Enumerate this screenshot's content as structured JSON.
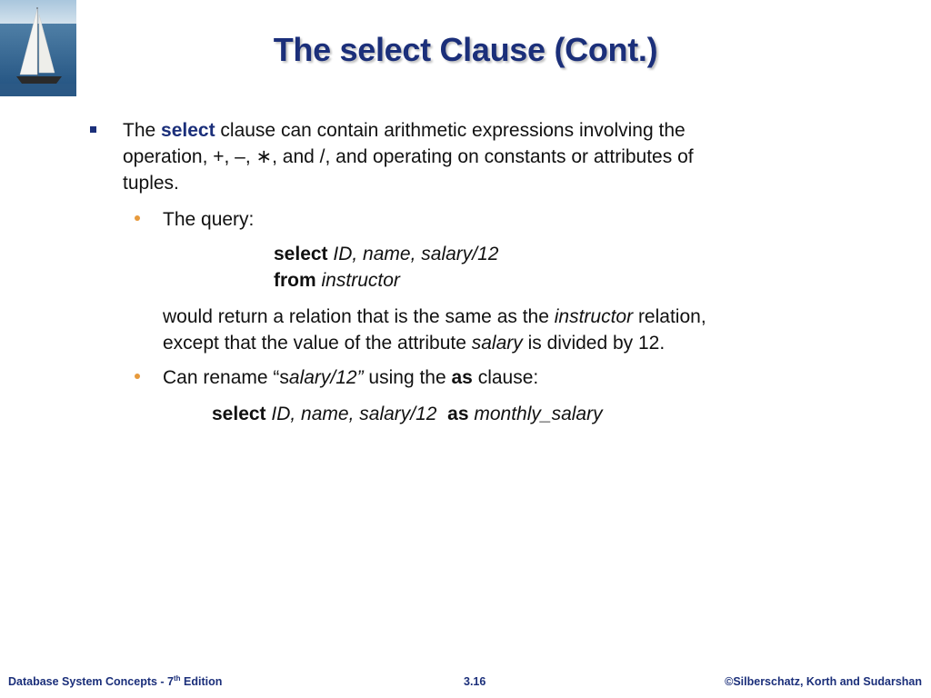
{
  "slide": {
    "title": "The select Clause (Cont.)",
    "logo_name": "sailboat-logo"
  },
  "bullet1": {
    "line1_pre": "The ",
    "line1_kw": "select",
    "line1_post": " clause can contain arithmetic expressions involving the",
    "line2": "operation, +, –, ∗, and /, and operating on constants or attributes of",
    "line3": "tuples."
  },
  "sub1": {
    "label": "The query:",
    "query_select_kw": "select",
    "query_select_args": "ID, name, salary/12",
    "query_from_kw": "from",
    "query_from_args": "instructor",
    "desc1_pre": "would return a relation that is the same as the ",
    "desc1_it": "instructor",
    "desc1_post": " relation,",
    "desc2_pre": "except that the value of the attribute ",
    "desc2_it": "salary",
    "desc2_post": " is divided by 12."
  },
  "sub2": {
    "label_pre": "Can rename “s",
    "label_it": "alary/12”",
    "label_mid": " using the ",
    "label_kw": "as",
    "label_post": " clause:",
    "q_select_kw": "select",
    "q_args": "ID, name, salary/12",
    "q_as_kw": "as",
    "q_alias": "monthly_salary"
  },
  "footer": {
    "left_pre": "Database System Concepts - 7",
    "left_sup": "th",
    "left_post": " Edition",
    "center": "3.16",
    "right": "©Silberschatz, Korth and Sudarshan"
  },
  "colors": {
    "title": "#1b2f7a",
    "bullet_square": "#1b2f7a",
    "bullet_dot": "#e79a3c",
    "footer": "#1b2f7a"
  }
}
